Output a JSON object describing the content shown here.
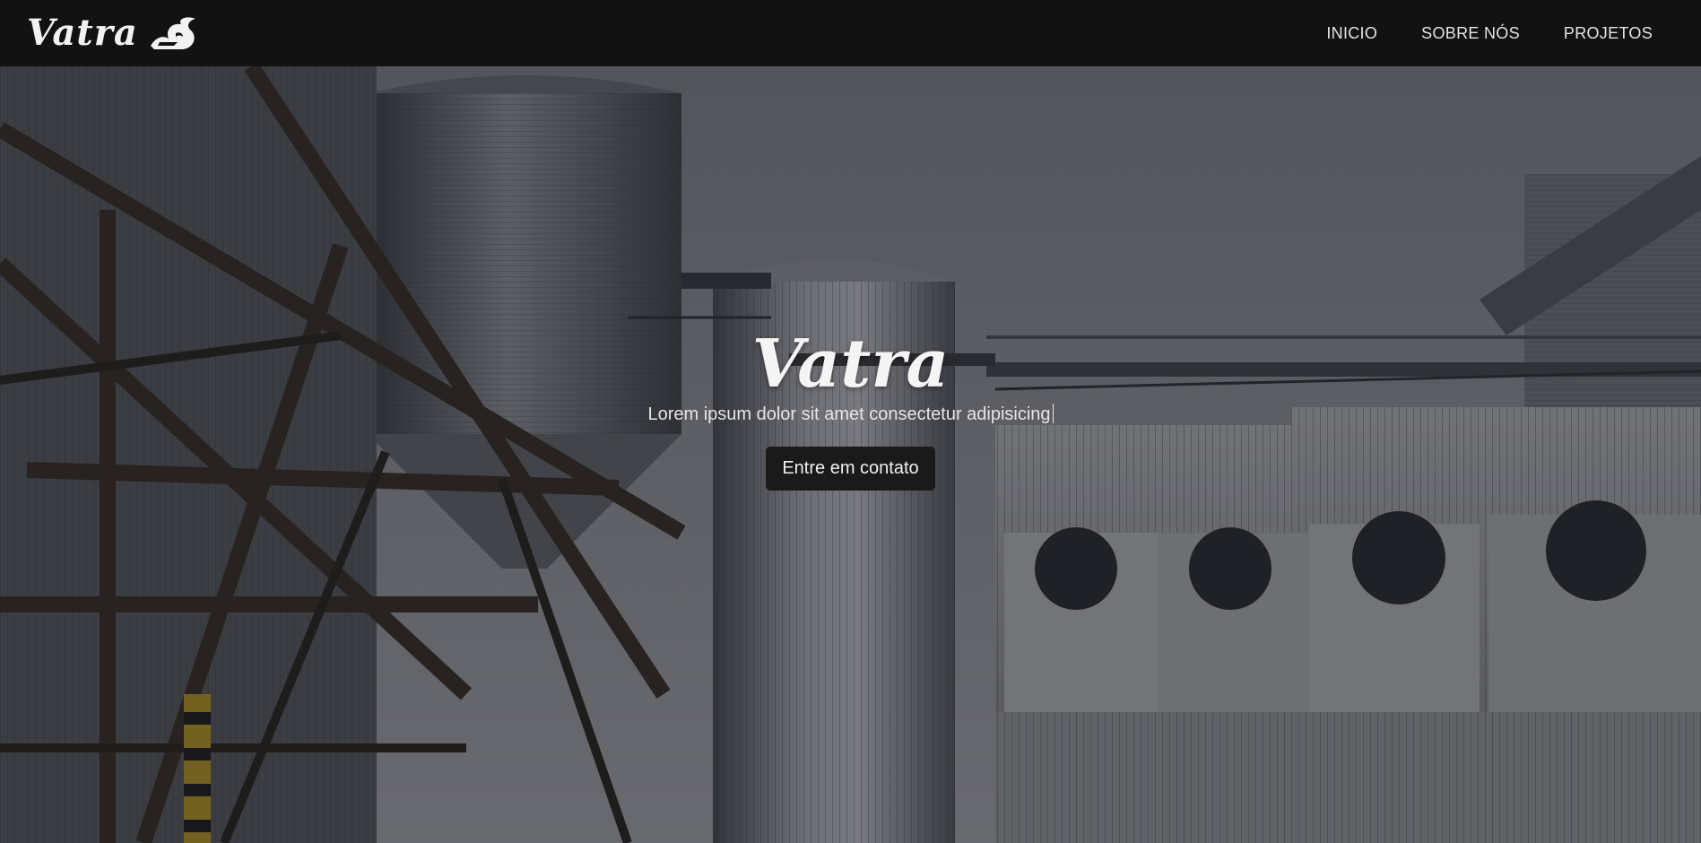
{
  "header": {
    "brand": "Vatra",
    "nav": [
      {
        "label": "INICIO"
      },
      {
        "label": "SOBRE NÓS"
      },
      {
        "label": "PROJETOS"
      }
    ]
  },
  "hero": {
    "title": "Vatra",
    "subtitle": "Lorem ipsum dolor sit amet consectetur adipisicing",
    "cta_label": "Entre em contato",
    "background": "industrial grain silos photo"
  },
  "colors": {
    "navbar": "#121212",
    "button": "#1a1a1a",
    "text": "#ffffff"
  }
}
